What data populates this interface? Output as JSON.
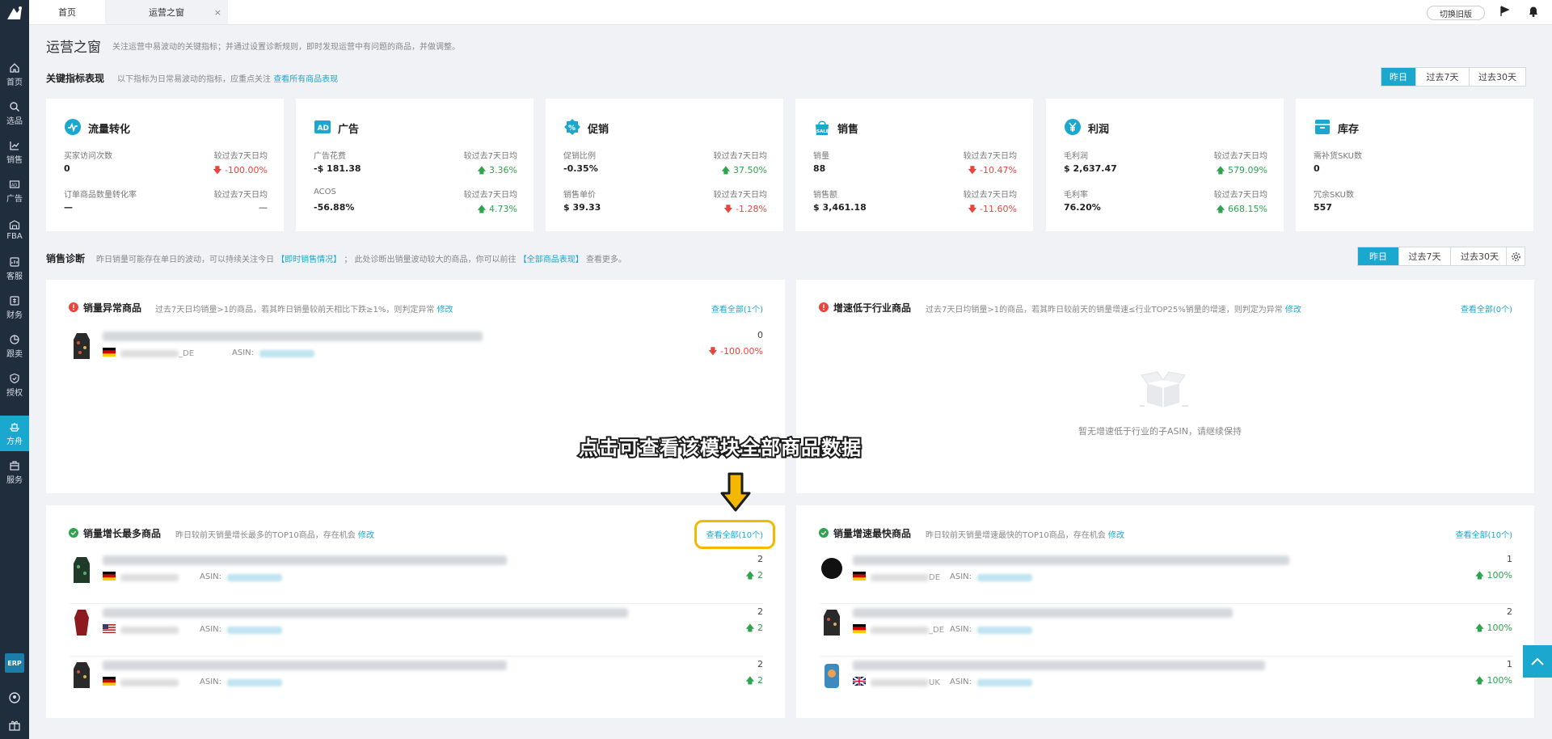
{
  "sidebar": {
    "items": [
      {
        "label": "首页",
        "icon": "home-icon"
      },
      {
        "label": "选品",
        "icon": "search-icon"
      },
      {
        "label": "销售",
        "icon": "chart-icon"
      },
      {
        "label": "广告",
        "icon": "ad-icon"
      },
      {
        "label": "FBA",
        "icon": "warehouse-icon"
      },
      {
        "label": "客服",
        "icon": "support-icon"
      },
      {
        "label": "财务",
        "icon": "finance-icon"
      },
      {
        "label": "跟卖",
        "icon": "pie-icon"
      },
      {
        "label": "授权",
        "icon": "shield-icon"
      },
      {
        "label": "方舟",
        "icon": "ark-icon"
      },
      {
        "label": "服务",
        "icon": "service-icon"
      }
    ],
    "active": "方舟",
    "erp_label": "ERP"
  },
  "topbar": {
    "tabs": [
      {
        "label": "首页"
      },
      {
        "label": "运营之窗",
        "close": "×"
      }
    ],
    "old_version_label": "切换旧版"
  },
  "header": {
    "title": "运营之窗",
    "desc": "关注运营中易波动的关键指标；并通过设置诊断规则，即时发现运营中有问题的商品，并做调整。"
  },
  "kpi_section": {
    "title": "关键指标表现",
    "desc": "以下指标为日常易波动的指标，应重点关注",
    "link": "查看所有商品表现",
    "ranges": [
      "昨日",
      "过去7天",
      "过去30天"
    ],
    "selected_range": "昨日"
  },
  "kpi_cards": [
    {
      "title": "流量转化",
      "icon": "traffic-icon",
      "rows": [
        {
          "label": "买家访问次数",
          "value": "0",
          "cmp": "较过去7天日均",
          "change": "-100.00%",
          "dir": "down"
        },
        {
          "label": "订单商品数量转化率",
          "value": "—",
          "cmp": "较过去7天日均",
          "change": "—",
          "dir": "none"
        }
      ]
    },
    {
      "title": "广告",
      "icon": "ad-icon",
      "rows": [
        {
          "label": "广告花费",
          "value": "-$ 181.38",
          "cmp": "较过去7天日均",
          "change": "3.36%",
          "dir": "up"
        },
        {
          "label": "ACOS",
          "value": "-56.88%",
          "cmp": "较过去7天日均",
          "change": "4.73%",
          "dir": "up"
        }
      ]
    },
    {
      "title": "促销",
      "icon": "promotion-icon",
      "rows": [
        {
          "label": "促销比例",
          "value": "-0.35%",
          "cmp": "较过去7天日均",
          "change": "37.50%",
          "dir": "up"
        },
        {
          "label": "销售单价",
          "value": "$ 39.33",
          "cmp": "较过去7天日均",
          "change": "-1.28%",
          "dir": "down"
        }
      ]
    },
    {
      "title": "销售",
      "icon": "sale-icon",
      "rows": [
        {
          "label": "销量",
          "value": "88",
          "cmp": "较过去7天日均",
          "change": "-10.47%",
          "dir": "down"
        },
        {
          "label": "销售额",
          "value": "$ 3,461.18",
          "cmp": "较过去7天日均",
          "change": "-11.60%",
          "dir": "down"
        }
      ]
    },
    {
      "title": "利润",
      "icon": "profit-icon",
      "rows": [
        {
          "label": "毛利润",
          "value": "$ 2,637.47",
          "cmp": "较过去7天日均",
          "change": "579.09%",
          "dir": "up"
        },
        {
          "label": "毛利率",
          "value": "76.20%",
          "cmp": "较过去7天日均",
          "change": "668.15%",
          "dir": "up"
        }
      ]
    },
    {
      "title": "库存",
      "icon": "inventory-icon",
      "rows": [
        {
          "label": "需补货SKU数",
          "value": "0",
          "cmp": "",
          "change": "",
          "dir": "none"
        },
        {
          "label": "冗余SKU数",
          "value": "557",
          "cmp": "",
          "change": "",
          "dir": "none"
        }
      ]
    }
  ],
  "diag_section": {
    "title": "销售诊断",
    "desc1": "昨日销量可能存在单日的波动，可以持续关注今日",
    "link1": "【即时销售情况】",
    "desc2": "；  此处诊断出销量波动较大的商品，你可以前往",
    "link2": "【全部商品表现】",
    "desc3": "查看更多。",
    "ranges": [
      "昨日",
      "过去7天",
      "过去30天"
    ],
    "selected_range": "昨日"
  },
  "panels": {
    "abnormal": {
      "title": "销量异常商品",
      "desc": "过去7天日均销量>1的商品，若其昨日销量较前天相比下跌≥1%，则判定异常",
      "edit": "修改",
      "view_all": "查看全部(1个)",
      "rows": [
        {
          "sku_suffix": "_DE",
          "asin_label": "ASIN:",
          "qty": "0",
          "change": "-100.00%",
          "dir": "down"
        }
      ]
    },
    "slow_growth": {
      "title": "增速低于行业商品",
      "desc": "过去7天日均销量>1的商品，若其昨日较前天的销量增速≤行业TOP25%销量的增速，则判定为异常",
      "edit": "修改",
      "view_all": "查看全部(0个)",
      "empty_text": "暂无增速低于行业的子ASIN，请继续保持"
    },
    "most_growth": {
      "title": "销量增长最多商品",
      "desc": "昨日较前天销量增长最多的TOP10商品，存在机会",
      "edit": "修改",
      "view_all": "查看全部(10个)",
      "rows": [
        {
          "sku_suffix": "",
          "asin_label": "ASIN:",
          "qty": "2",
          "change": "2",
          "dir": "up"
        },
        {
          "sku_suffix": "",
          "asin_label": "ASIN:",
          "qty": "2",
          "change": "2",
          "dir": "up"
        },
        {
          "sku_suffix": "",
          "asin_label": "ASIN:",
          "qty": "2",
          "change": "2",
          "dir": "up"
        }
      ]
    },
    "fastest_growth": {
      "title": "销量增速最快商品",
      "desc": "昨日较前天销量增速最快的TOP10商品，存在机会",
      "edit": "修改",
      "view_all": "查看全部(10个)",
      "rows": [
        {
          "sku_suffix": "DE",
          "asin_label": "ASIN:",
          "qty": "1",
          "change": "100%",
          "dir": "up"
        },
        {
          "sku_suffix": "_DE",
          "asin_label": "ASIN:",
          "qty": "2",
          "change": "100%",
          "dir": "up"
        },
        {
          "sku_suffix": "UK",
          "asin_label": "ASIN:",
          "qty": "1",
          "change": "100%",
          "dir": "up"
        }
      ]
    }
  },
  "annotation": {
    "callout": "点击可查看该模块全部商品数据"
  },
  "colors": {
    "accent": "#1aa8cf",
    "up": "#2ea44f",
    "down": "#e8453c",
    "highlight": "#f5b800",
    "sidebar": "#1f2d3d"
  }
}
